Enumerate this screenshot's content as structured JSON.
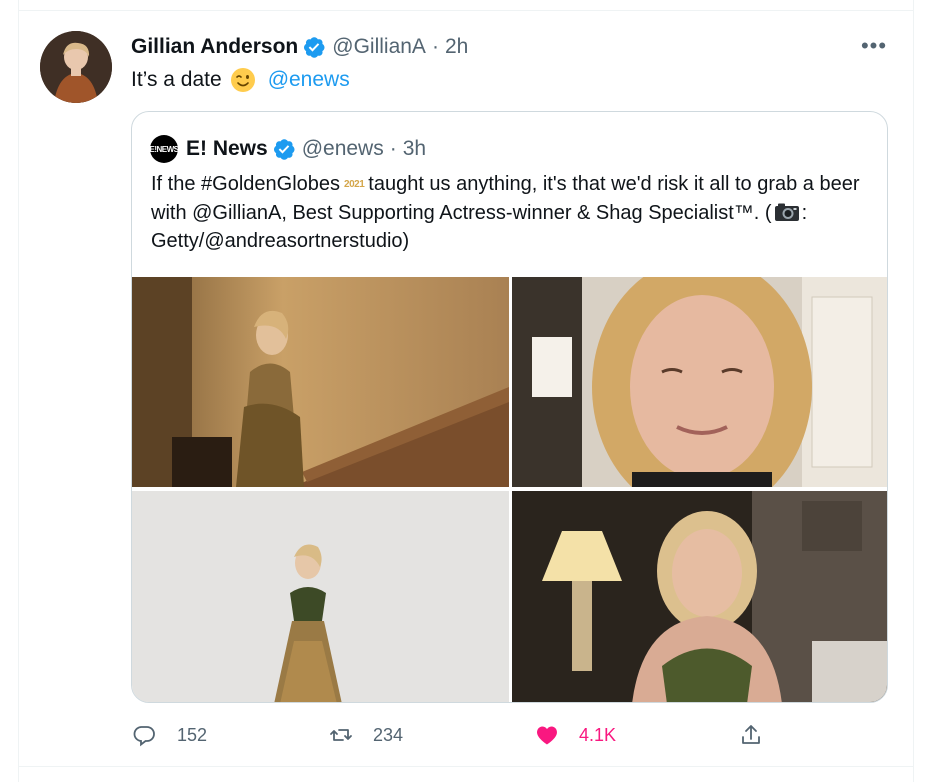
{
  "tweet": {
    "author_name": "Gillian Anderson",
    "author_handle": "@GillianA",
    "separator": "·",
    "time": "2h",
    "more_label": "•••",
    "text_before": "It’s a date",
    "emoji": "winking-face-emoji",
    "mention": "@enews"
  },
  "quoted": {
    "logo_text": "E!NEWS",
    "author_name": "E! News",
    "author_handle": "@enews",
    "separator": "·",
    "time": "3h",
    "text_part1": "If the #GoldenGlobes",
    "badge": "2021",
    "text_part2": "taught us anything, it's that we'd risk it all to grab a beer with @GillianA, Best Supporting Actress-winner & Shag Specialist™. (",
    "text_part3": ": Getty/@andreasortnerstudio)",
    "photos": [
      "photo-staircase-gown",
      "photo-selfie-closeup",
      "photo-studio-fullbody",
      "photo-lamp-room"
    ]
  },
  "actions": {
    "replies": "152",
    "retweets": "234",
    "likes": "4.1K",
    "liked": true,
    "like_color": "#f91880",
    "accent_color": "#1d9bf0"
  }
}
